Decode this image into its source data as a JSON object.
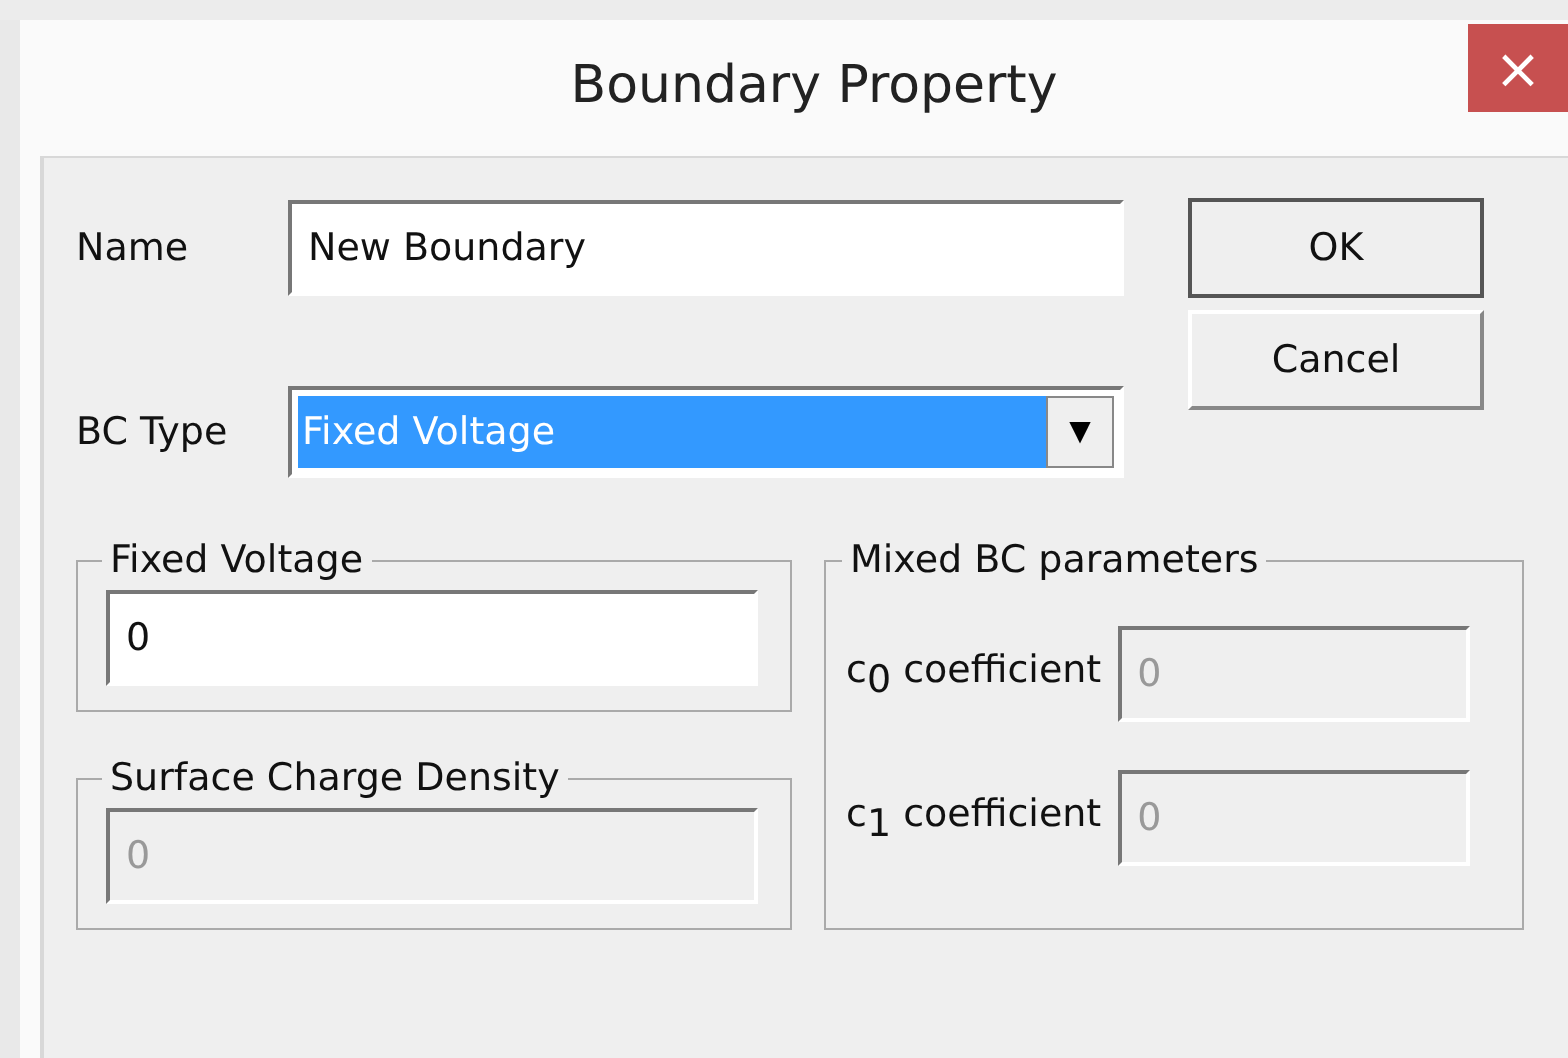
{
  "window": {
    "title": "Boundary Property",
    "close": "×"
  },
  "name": {
    "label": "Name",
    "value": "New Boundary"
  },
  "bc_type": {
    "label": "BC Type",
    "value": "Fixed Voltage",
    "arrow": "▼"
  },
  "buttons": [
    {
      "label": "OK",
      "default": true
    },
    {
      "label": "Cancel",
      "default": false
    }
  ],
  "fixed_voltage": {
    "title": "Fixed Voltage",
    "value": "0",
    "disabled": false
  },
  "surface_charge_density": {
    "title": "Surface Charge Density",
    "value": "0",
    "disabled": true
  },
  "mixed_bc_parameters": {
    "title": "Mixed BC parameters",
    "rows": [
      {
        "label": "c$_{0}$ coefficient",
        "value": "0",
        "disabled": true
      },
      {
        "label": "c$_{1}$ coefficient",
        "value": "0",
        "disabled": true
      }
    ]
  }
}
